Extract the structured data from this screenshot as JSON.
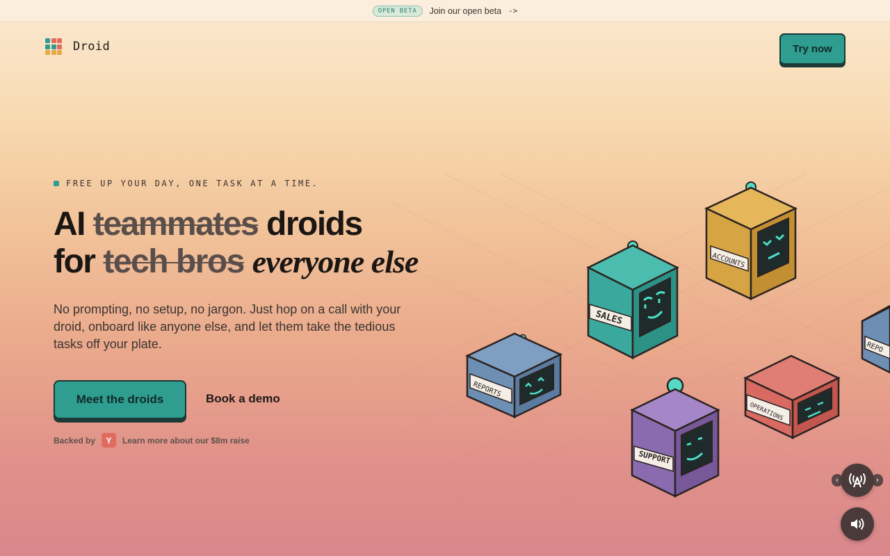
{
  "announcement": {
    "badge": "OPEN BETA",
    "text": "Join our open beta",
    "arrow": "->"
  },
  "header": {
    "brand": "Droid",
    "cta_label": "Try now"
  },
  "hero": {
    "tagline": "FREE UP YOUR DAY, ONE TASK AT A TIME.",
    "line1_start": "AI",
    "line1_struck": "teammates",
    "line1_end": "droids",
    "line2_start": "for",
    "line2_struck": "tech bros",
    "line2_italic": "everyone else",
    "subcopy": "No prompting, no setup, no jargon. Just hop on a call with your droid, onboard like anyone else, and let them take the tedious tasks off your plate.",
    "primary_cta": "Meet the droids",
    "secondary_cta": "Book a demo",
    "backed_by_label": "Backed by",
    "backer_mark": "Y",
    "raise_link": "Learn more about our $8m raise"
  },
  "droids": {
    "sales": "SALES",
    "accounts": "ACCOUNTS",
    "reports": "REPORTS",
    "operations": "OPERATIONS",
    "support": "SUPPORT",
    "reports_edge": "REPO"
  },
  "controls": {
    "main_icon": "antenna-a-icon",
    "prev_icon": "chevron-left-icon",
    "next_icon": "chevron-right-icon",
    "sound_icon": "speaker-icon"
  },
  "colors": {
    "accent": "#2f9d90",
    "sales": "#3aa89c",
    "accounts": "#d7a443",
    "reports": "#6d8fb4",
    "operations": "#d86a62",
    "support": "#8b6bb0",
    "screen": "#1f2b2b",
    "eyes": "#4be0c8"
  },
  "logo_colors": [
    "#2f9d90",
    "#e26a5e",
    "#e26a5e",
    "#2f9d90",
    "#2f9d90",
    "#e26a5e",
    "#e6a94a",
    "#e6a94a",
    "#e6a94a"
  ]
}
